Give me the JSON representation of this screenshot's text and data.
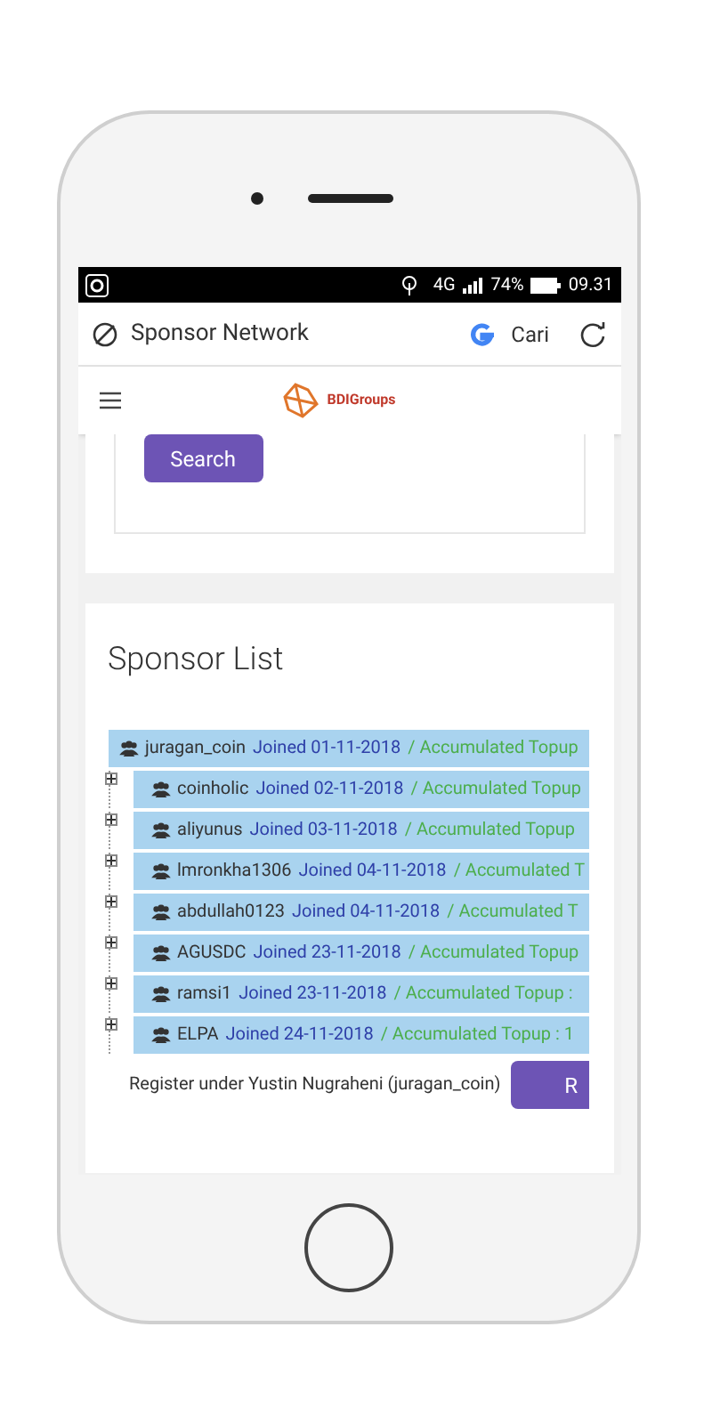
{
  "status_bar": {
    "network": "4G",
    "battery": "74%",
    "time": "09.31"
  },
  "browser": {
    "title": "Sponsor Network",
    "search_label": "Cari"
  },
  "nav": {
    "brand": "BDIGroups"
  },
  "search_button": "Search",
  "sponsor_list": {
    "title": "Sponsor List",
    "root": {
      "name": "juragan_coin",
      "joined": "Joined 01-11-2018",
      "topup": "/ Accumulated Topup"
    },
    "children": [
      {
        "name": "coinholic",
        "joined": "Joined 02-11-2018",
        "topup": "/ Accumulated Topup",
        "expanded": false
      },
      {
        "name": "aliyunus",
        "joined": "Joined 03-11-2018",
        "topup": "/ Accumulated Topup",
        "expanded": false
      },
      {
        "name": "lmronkha1306",
        "joined": "Joined 04-11-2018",
        "topup": "/ Accumulated T",
        "expanded": false
      },
      {
        "name": "abdullah0123",
        "joined": "Joined 04-11-2018",
        "topup": "/ Accumulated T",
        "expanded": false
      },
      {
        "name": "AGUSDC",
        "joined": "Joined 23-11-2018",
        "topup": "/ Accumulated Topup",
        "expanded": false
      },
      {
        "name": "ramsi1",
        "joined": "Joined 23-11-2018",
        "topup": "/ Accumulated Topup :",
        "expanded": false
      },
      {
        "name": "ELPA",
        "joined": "Joined 24-11-2018",
        "topup": "/ Accumulated Topup : 1",
        "expanded": false
      }
    ],
    "register_note": "Register under Yustin Nugraheni (juragan_coin)",
    "register_button": "R"
  }
}
